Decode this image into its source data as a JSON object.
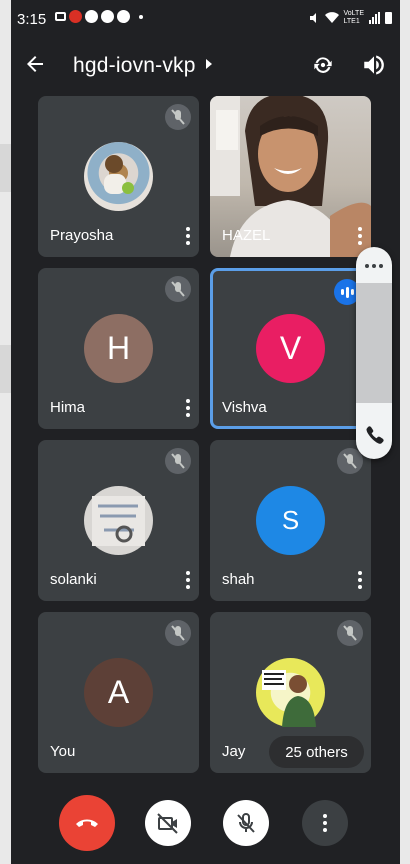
{
  "status_bar": {
    "time": "3:15"
  },
  "header": {
    "title": "hgd-iovn-vkp"
  },
  "participants": [
    {
      "name": "Prayosha",
      "muted": true,
      "kind": "photo"
    },
    {
      "name": "HAZEL",
      "muted": false,
      "kind": "video"
    },
    {
      "name": "Hima",
      "initial": "H",
      "color": "#8d6e63",
      "muted": true,
      "kind": "initial"
    },
    {
      "name": "Vishva",
      "initial": "V",
      "color": "#e91e63",
      "muted": false,
      "speaking": true,
      "kind": "initial"
    },
    {
      "name": "solanki",
      "muted": true,
      "kind": "photo"
    },
    {
      "name": "shah",
      "initial": "S",
      "color": "#1e88e5",
      "muted": true,
      "kind": "initial"
    },
    {
      "name": "You",
      "initial": "A",
      "color": "#5d4037",
      "muted": true,
      "kind": "initial"
    },
    {
      "name": "Jay",
      "muted": true,
      "kind": "photo"
    }
  ],
  "others": {
    "label": "25 others"
  },
  "controls": {
    "end_call": "end-call-icon",
    "camera": "camera-off-icon",
    "mic": "mic-off-icon",
    "more": "more-vert-icon"
  },
  "colors": {
    "background": "#202124",
    "tile": "#3c4043",
    "accent": "#1a73e8",
    "end_call": "#ea4335"
  }
}
